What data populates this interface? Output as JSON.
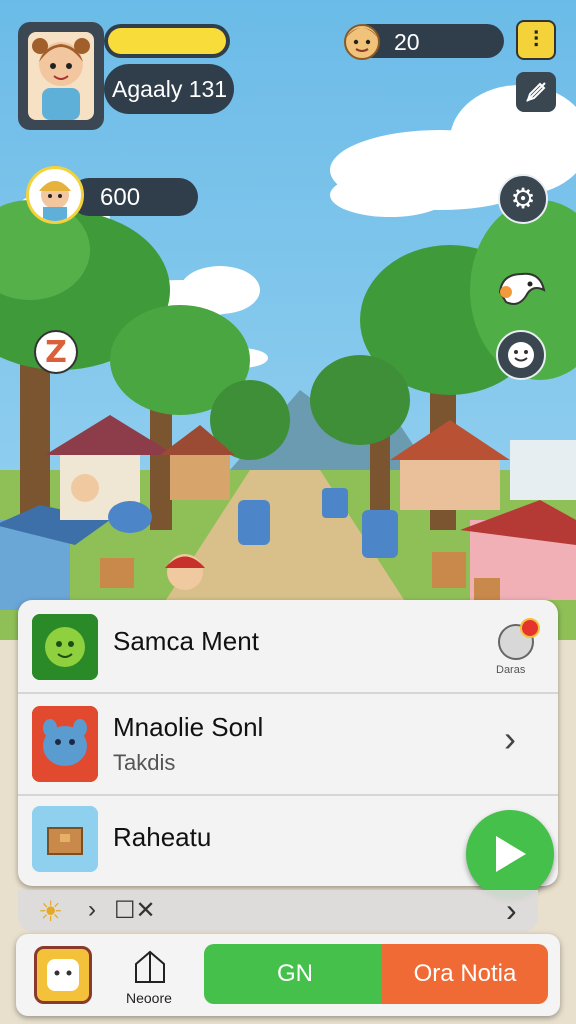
{
  "player": {
    "name": "Agaaly 131",
    "xp_fill": 1.0
  },
  "currency": {
    "value": "20"
  },
  "coins": {
    "value": "600"
  },
  "tasks": [
    {
      "title": "Samca Ment",
      "badge": "Daras"
    },
    {
      "title": "Mnaolie Sonl",
      "subtitle": "Takdis"
    },
    {
      "title": "Raheatu"
    }
  ],
  "bottom": {
    "home_label": "Neoore",
    "go_label": "GN",
    "orange_label": "Ora Notia"
  },
  "icons": {
    "player_avatar": "avatar-girl-icon",
    "currency": "coin-face-icon",
    "menu": "menu-icon",
    "edit": "edit-icon",
    "settings": "gear-icon",
    "pet": "goat-icon",
    "emoji": "smile-icon",
    "sleep": "sleep-z-icon",
    "play": "play-icon",
    "chevron": "chevron-right-icon",
    "sun": "sun-icon",
    "house": "house-icon"
  },
  "colors": {
    "green": "#45c04a",
    "orange": "#f06a35",
    "yellow_bar": "#f7dc3a",
    "dark_pill": "#2f3e4a"
  }
}
